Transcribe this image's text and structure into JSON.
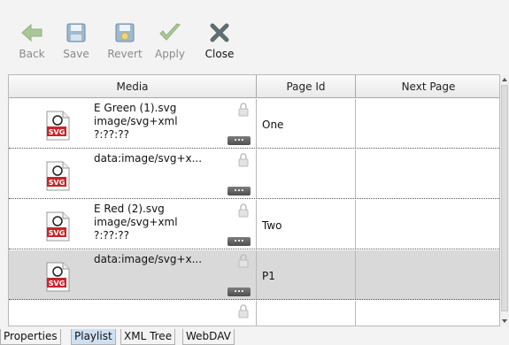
{
  "toolbar": {
    "back_label": "Back",
    "save_label": "Save",
    "revert_label": "Revert",
    "apply_label": "Apply",
    "close_label": "Close"
  },
  "grid": {
    "columns": [
      "Media",
      "Page Id",
      "Next Page"
    ],
    "rows": [
      {
        "name": "E Green (1).svg",
        "type": "image/svg+xml",
        "duration": "?:??:??",
        "page_id": "One",
        "next_page": ""
      },
      {
        "name": "data:image/svg+x...",
        "type": "",
        "duration": "",
        "page_id": "",
        "next_page": ""
      },
      {
        "name": "E Red (2).svg",
        "type": "image/svg+xml",
        "duration": "?:??:??",
        "page_id": "Two",
        "next_page": ""
      },
      {
        "name": "data:image/svg+x...",
        "type": "",
        "duration": "",
        "page_id": "P1",
        "next_page": ""
      },
      {
        "name": "",
        "type": "",
        "duration": "",
        "page_id": "",
        "next_page": ""
      }
    ],
    "file_badge": "SVG",
    "more_label": "..."
  },
  "tabs": [
    "Properties",
    "Playlist",
    "XML Tree",
    "WebDAV"
  ],
  "active_tab": "Playlist",
  "icons": {
    "back": "back-arrow-icon",
    "save": "save-disk-icon",
    "revert": "revert-icon",
    "apply": "checkmark-icon",
    "close": "close-x-icon",
    "file": "svg-file-icon",
    "lock": "lock-icon"
  },
  "colors": {
    "selected_row": "#d9d9d9",
    "active_tab": "#cfe0f3",
    "close_icon": "#5f6e71",
    "disabled_green": "#a9c79a"
  }
}
